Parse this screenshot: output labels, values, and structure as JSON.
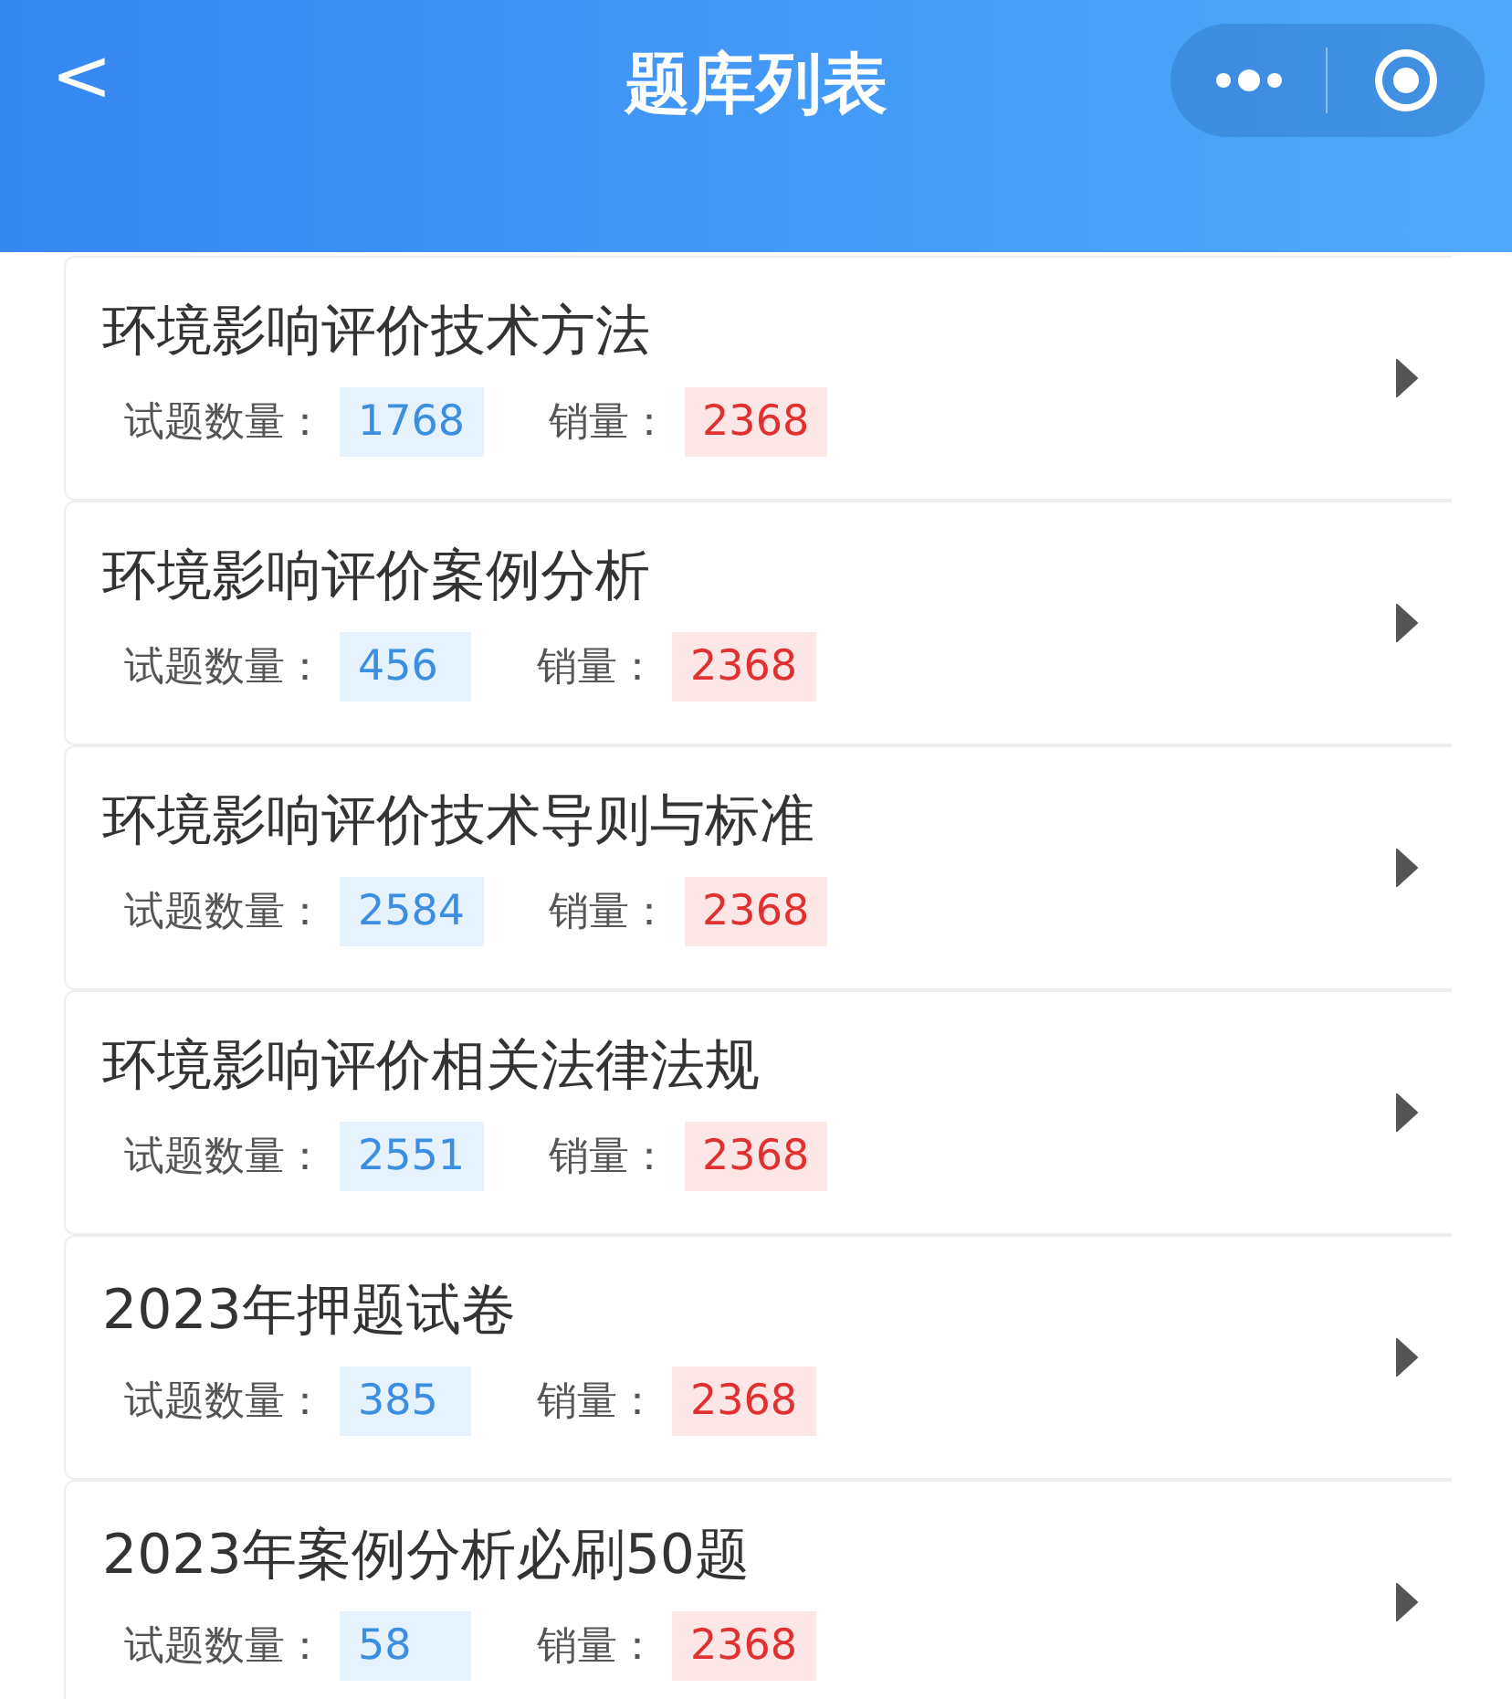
{
  "header": {
    "back": "<",
    "title": "题库列表"
  },
  "items": [
    {
      "title": "环境影响评价技术方法",
      "count_label": "试题数量：",
      "count": "1768",
      "sales_label": "销量：",
      "sales": "2368"
    },
    {
      "title": "环境影响评价案例分析",
      "count_label": "试题数量：",
      "count": "456",
      "sales_label": "销量：",
      "sales": "2368"
    },
    {
      "title": "环境影响评价技术导则与标准",
      "count_label": "试题数量：",
      "count": "2584",
      "sales_label": "销量：",
      "sales": "2368"
    },
    {
      "title": "环境影响评价相关法律法规",
      "count_label": "试题数量：",
      "count": "2551",
      "sales_label": "销量：",
      "sales": "2368"
    },
    {
      "title": "2023年押题试卷",
      "count_label": "试题数量：",
      "count": "385",
      "sales_label": "销量：",
      "sales": "2368"
    },
    {
      "title": "2023年案例分析必刷50题",
      "count_label": "试题数量：",
      "count": "58",
      "sales_label": "销量：",
      "sales": "2368"
    }
  ]
}
